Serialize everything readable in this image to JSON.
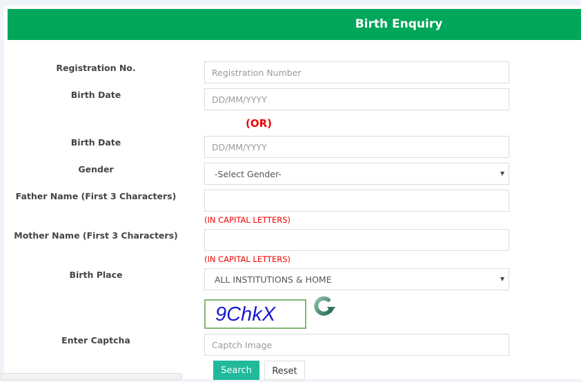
{
  "header": {
    "title": "Birth Enquiry",
    "color": "#00a65a"
  },
  "form": {
    "registration_no": {
      "label": "Registration No.",
      "placeholder": "Registration Number",
      "value": ""
    },
    "birth_date_1": {
      "label": "Birth Date",
      "placeholder": "DD/MM/YYYY",
      "value": ""
    },
    "or_text": "(OR)",
    "birth_date_2": {
      "label": "Birth Date",
      "placeholder": "DD/MM/YYYY",
      "value": ""
    },
    "gender": {
      "label": "Gender",
      "selected": "-Select Gender-"
    },
    "father_name": {
      "label": "Father Name (First 3 Characters)",
      "value": "",
      "hint": "(IN CAPITAL LETTERS)"
    },
    "mother_name": {
      "label": "Mother Name (First 3 Characters)",
      "value": "",
      "hint": "(IN CAPITAL LETTERS)"
    },
    "birth_place": {
      "label": "Birth Place",
      "selected": "ALL INSTITUTIONS & HOME"
    },
    "captcha": {
      "image_text": "9ChkX",
      "label": "Enter Captcha",
      "placeholder": "Captch Image",
      "value": ""
    },
    "buttons": {
      "search": "Search",
      "reset": "Reset"
    }
  },
  "colors": {
    "accent": "#00a65a",
    "button": "#21b99a",
    "warning": "#ee0000"
  }
}
